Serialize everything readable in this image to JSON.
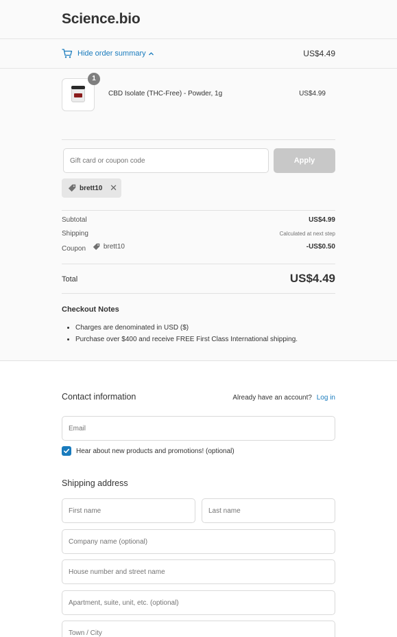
{
  "header": {
    "logo": "Science.bio"
  },
  "summary_toggle": {
    "label": "Hide order summary",
    "total": "US$4.49",
    "chevron": "chevron-up-icon"
  },
  "product": {
    "name": "CBD Isolate (THC-Free) - Powder, 1g",
    "price": "US$4.99",
    "quantity": "1"
  },
  "discount": {
    "placeholder": "Gift card or coupon code",
    "apply_label": "Apply",
    "applied_code": "brett10"
  },
  "totals": {
    "subtotal_label": "Subtotal",
    "subtotal_value": "US$4.99",
    "shipping_label": "Shipping",
    "shipping_value": "Calculated at next step",
    "coupon_label": "Coupon",
    "coupon_code": "brett10",
    "coupon_value": "-US$0.50",
    "total_label": "Total",
    "total_value": "US$4.49"
  },
  "notes": {
    "title": "Checkout Notes",
    "items": [
      "Charges are denominated in USD ($)",
      "Purchase over $400 and receive FREE First Class International shipping."
    ]
  },
  "contact": {
    "title": "Contact information",
    "account_prompt": "Already have an account?",
    "login_label": "Log in",
    "email_placeholder": "Email",
    "newsletter_label": "Hear about new products and promotions! (optional)",
    "newsletter_checked": true
  },
  "shipping": {
    "title": "Shipping address",
    "first_name_placeholder": "First name",
    "last_name_placeholder": "Last name",
    "company_placeholder": "Company name (optional)",
    "address_placeholder": "House number and street name",
    "apartment_placeholder": "Apartment, suite, unit, etc. (optional)",
    "city_placeholder": "Town / City"
  },
  "colors": {
    "accent": "#197bbd",
    "summary_bg": "#fafafa",
    "apply_disabled": "#c8c8c8"
  }
}
